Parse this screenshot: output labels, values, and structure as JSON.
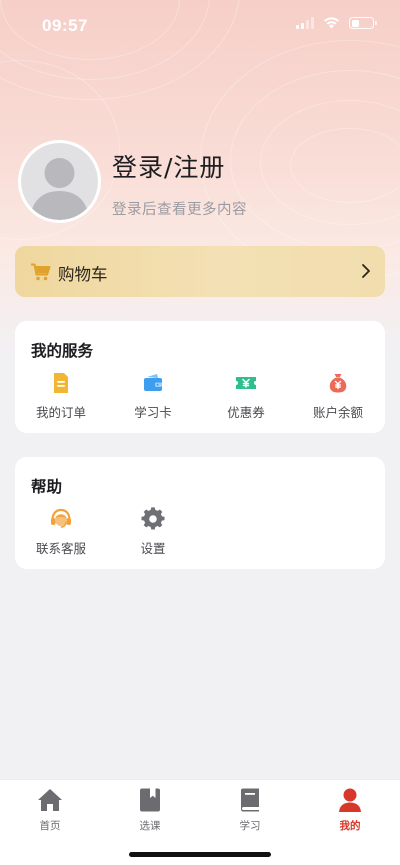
{
  "status_bar": {
    "time": "09:57",
    "battery_level": 0.35
  },
  "profile": {
    "title": "登录/注册",
    "subtitle": "登录后查看更多内容",
    "avatar_icon": "default-avatar-icon"
  },
  "cart": {
    "label": "购物车",
    "icon": "shopping-cart-icon"
  },
  "services": {
    "title": "我的服务",
    "items": [
      {
        "label": "我的订单",
        "icon": "order-document-icon",
        "color": "#f2b632"
      },
      {
        "label": "学习卡",
        "icon": "wallet-card-icon",
        "color": "#3d9ef0"
      },
      {
        "label": "优惠券",
        "icon": "coupon-ticket-icon",
        "color": "#2fbf8c"
      },
      {
        "label": "账户余额",
        "icon": "money-bag-icon",
        "color": "#ec6a5a"
      }
    ]
  },
  "help": {
    "title": "帮助",
    "items": [
      {
        "label": "联系客服",
        "icon": "customer-service-icon",
        "color": "#f2a23a"
      },
      {
        "label": "设置",
        "icon": "settings-gear-icon",
        "color": "#6f6f76"
      }
    ]
  },
  "tabbar": {
    "active_index": 3,
    "active_color": "#d8382a",
    "inactive_color": "#6b6b70",
    "tabs": [
      {
        "label": "首页",
        "icon": "home-icon"
      },
      {
        "label": "选课",
        "icon": "course-bookmark-icon"
      },
      {
        "label": "学习",
        "icon": "study-book-icon"
      },
      {
        "label": "我的",
        "icon": "user-profile-icon"
      }
    ]
  }
}
